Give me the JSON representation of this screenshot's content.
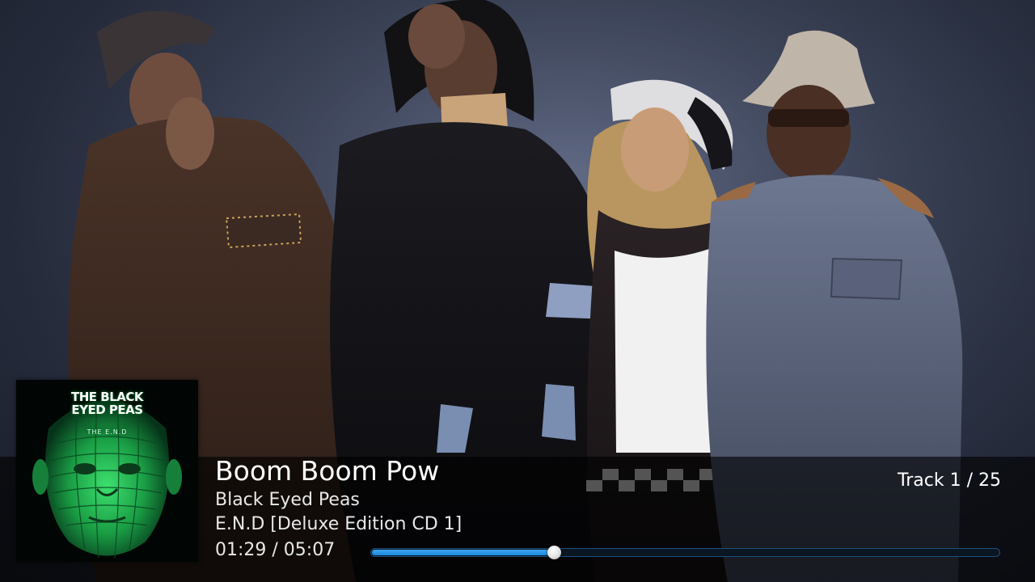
{
  "now_playing": {
    "title": "Boom Boom Pow",
    "artist": "Black Eyed Peas",
    "album": "E.N.D [Deluxe Edition CD 1]",
    "time_display": "01:29 / 05:07",
    "track_display": "Track 1 / 25",
    "progress_fraction": 0.29
  },
  "album_art": {
    "line1": "THE BLACK",
    "line2": "EYED PEAS",
    "line3": "THE E.N.D"
  },
  "colors": {
    "progress_fill": "#1a8ae0",
    "accent_green": "#27c85a"
  },
  "icons": {
    "progress_knob": "circle-knob"
  }
}
